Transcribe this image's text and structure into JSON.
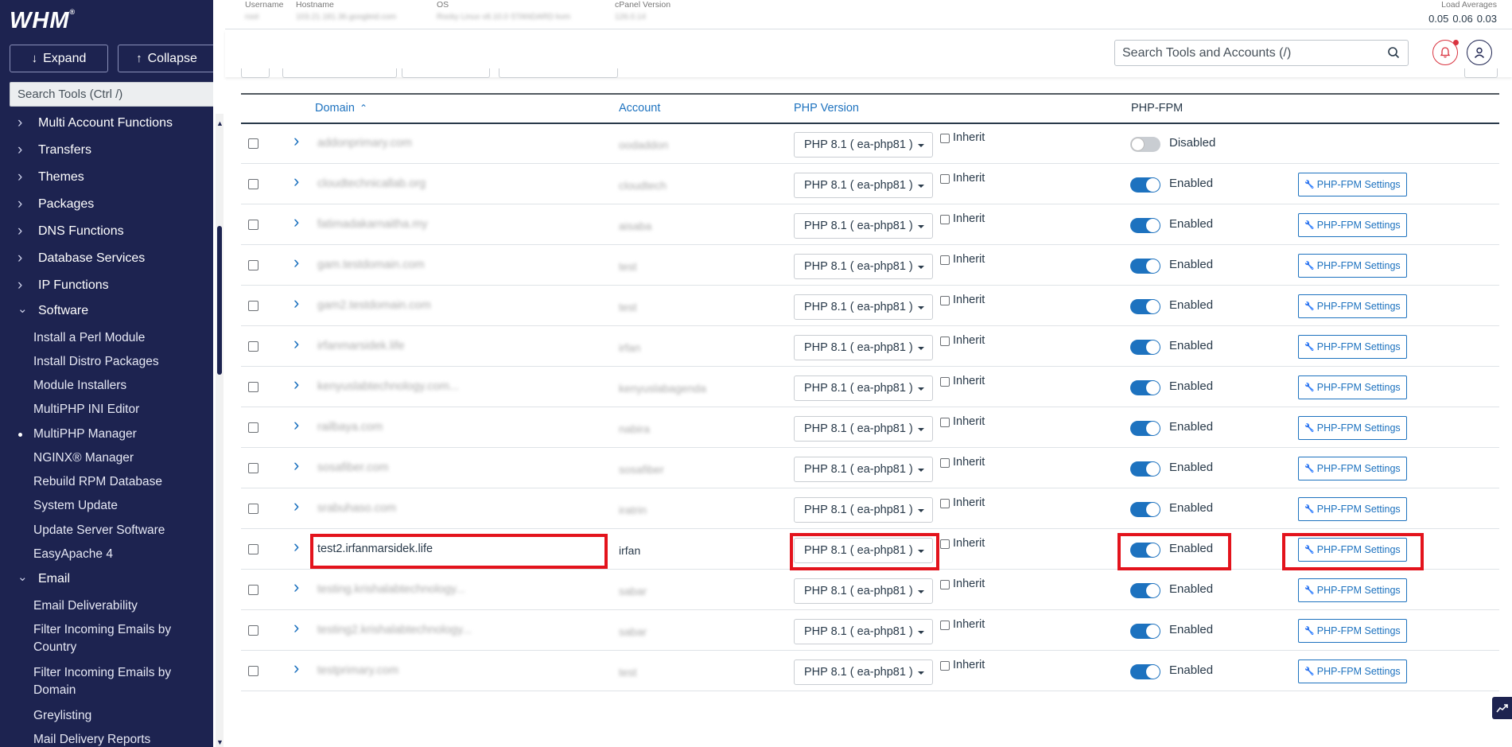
{
  "brand": {
    "logo": "WHM",
    "mark": "®"
  },
  "sidebar": {
    "expand_label": "Expand",
    "collapse_label": "Collapse",
    "search_placeholder": "Search Tools (Ctrl /)",
    "categories": [
      "Multi Account Functions",
      "Transfers",
      "Themes",
      "Packages",
      "DNS Functions",
      "Database Services",
      "IP Functions",
      "Software",
      "Email"
    ],
    "software_items": [
      "Install a Perl Module",
      "Install Distro Packages",
      "Module Installers",
      "MultiPHP INI Editor",
      "MultiPHP Manager",
      "NGINX® Manager",
      "Rebuild RPM Database",
      "System Update",
      "Update Server Software",
      "EasyApache 4"
    ],
    "email_items": [
      "Email Deliverability",
      "Filter Incoming Emails by Country",
      "Filter Incoming Emails by Domain",
      "Greylisting",
      "Mail Delivery Reports"
    ],
    "active_item": "MultiPHP Manager"
  },
  "info_bar": {
    "username_label": "Username",
    "hostname_label": "Hostname",
    "os_label": "OS",
    "cpanel_label": "cPanel Version",
    "username_value": "root",
    "hostname_value": "103.21.181.36.googleid.com",
    "os_value": "Rocky Linux v8.10.0 STANDARD kvm",
    "cpanel_value": "126.0.14",
    "load_label": "Load Averages",
    "load_values": [
      "0.05",
      "0.06",
      "0.03"
    ]
  },
  "header": {
    "search_placeholder": "Search Tools and Accounts (/)"
  },
  "table": {
    "headers": {
      "domain": "Domain",
      "account": "Account",
      "php_version": "PHP Version",
      "php_fpm": "PHP-FPM"
    },
    "inherit_label": "Inherit",
    "fpm_button_label": "PHP-FPM Settings",
    "rows": [
      {
        "domain": "addonprimary.com",
        "account": "oodaddon",
        "php": "PHP 8.1 ( ea-php81 )",
        "fpm": "Disabled",
        "fpm_on": false,
        "settings": false,
        "blur": true
      },
      {
        "domain": "cloudtechnicallab.org",
        "account": "cloudtech",
        "php": "PHP 8.1 ( ea-php81 )",
        "fpm": "Enabled",
        "fpm_on": true,
        "settings": true,
        "blur": true
      },
      {
        "domain": "fatimadakarnaitha.my",
        "account": "aisaba",
        "php": "PHP 8.1 ( ea-php81 )",
        "fpm": "Enabled",
        "fpm_on": true,
        "settings": true,
        "blur": true
      },
      {
        "domain": "gam.testdomain.com",
        "account": "test",
        "php": "PHP 8.1 ( ea-php81 )",
        "fpm": "Enabled",
        "fpm_on": true,
        "settings": true,
        "blur": true
      },
      {
        "domain": "gam2.testdomain.com",
        "account": "test",
        "php": "PHP 8.1 ( ea-php81 )",
        "fpm": "Enabled",
        "fpm_on": true,
        "settings": true,
        "blur": true
      },
      {
        "domain": "irfanmarsidek.life",
        "account": "irfan",
        "php": "PHP 8.1 ( ea-php81 )",
        "fpm": "Enabled",
        "fpm_on": true,
        "settings": true,
        "blur": true
      },
      {
        "domain": "kenyuslabtechnology.com...",
        "account": "kenyuslabagenda",
        "php": "PHP 8.1 ( ea-php81 )",
        "fpm": "Enabled",
        "fpm_on": true,
        "settings": true,
        "blur": true
      },
      {
        "domain": "railbaya.com",
        "account": "nabira",
        "php": "PHP 8.1 ( ea-php81 )",
        "fpm": "Enabled",
        "fpm_on": true,
        "settings": true,
        "blur": true
      },
      {
        "domain": "sosafiber.com",
        "account": "sosafiber",
        "php": "PHP 8.1 ( ea-php81 )",
        "fpm": "Enabled",
        "fpm_on": true,
        "settings": true,
        "blur": true
      },
      {
        "domain": "srabuhaso.com",
        "account": "iratrin",
        "php": "PHP 8.1 ( ea-php81 )",
        "fpm": "Enabled",
        "fpm_on": true,
        "settings": true,
        "blur": true
      },
      {
        "domain": "test2.irfanmarsidek.life",
        "account": "irfan",
        "php": "PHP 8.1 ( ea-php81 )",
        "fpm": "Enabled",
        "fpm_on": true,
        "settings": true,
        "blur": false
      },
      {
        "domain": "testing.krishalabtechnology...",
        "account": "sabar",
        "php": "PHP 8.1 ( ea-php81 )",
        "fpm": "Enabled",
        "fpm_on": true,
        "settings": true,
        "blur": true
      },
      {
        "domain": "testing2.krishalabtechnology...",
        "account": "sabar",
        "php": "PHP 8.1 ( ea-php81 )",
        "fpm": "Enabled",
        "fpm_on": true,
        "settings": true,
        "blur": true
      },
      {
        "domain": "testprimary.com",
        "account": "test",
        "php": "PHP 8.1 ( ea-php81 )",
        "fpm": "Enabled",
        "fpm_on": true,
        "settings": true,
        "blur": true
      }
    ]
  },
  "colors": {
    "sidebar_bg": "#1d2350",
    "accent": "#1d72bf",
    "highlight": "#e3131c"
  }
}
